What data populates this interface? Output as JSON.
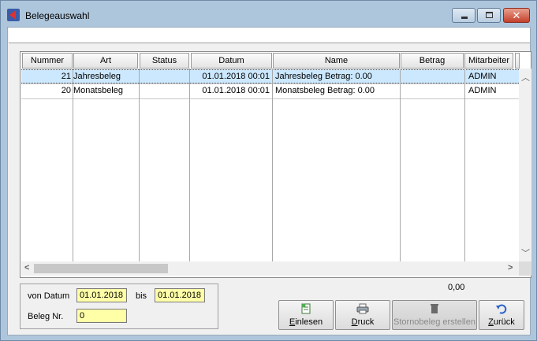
{
  "window": {
    "title": "Belegeauswahl",
    "controls": {
      "minimize": "–",
      "maximize": "□",
      "close": "✕"
    }
  },
  "table": {
    "headers": [
      "Nummer",
      "Art",
      "Status",
      "Datum",
      "Name",
      "Betrag",
      "Mitarbeiter"
    ],
    "rows": [
      {
        "nummer": "21",
        "art": "Jahresbeleg",
        "status": "",
        "datum": "01.01.2018  00:01",
        "name": "Jahresbeleg Betrag: 0.00",
        "betrag": "",
        "mitarbeiter": "ADMIN",
        "selected": true
      },
      {
        "nummer": "20",
        "art": "Monatsbeleg",
        "status": "",
        "datum": "01.01.2018  00:01",
        "name": "Monatsbeleg Betrag: 0.00",
        "betrag": "",
        "mitarbeiter": "ADMIN",
        "selected": false
      }
    ],
    "scroll": {
      "left": "<",
      "right": ">",
      "up": "︿",
      "down": "﹀"
    }
  },
  "filter": {
    "von_label": "von Datum",
    "von_value": "01.01.2018",
    "bis_label": "bis",
    "bis_value": "01.01.2018",
    "beleg_label": "Beleg Nr.",
    "beleg_value": "0"
  },
  "summary": {
    "total": "0,00"
  },
  "buttons": {
    "einlesen": {
      "hotkey": "E",
      "rest": "inlesen",
      "icon": "import-icon"
    },
    "druck": {
      "hotkey": "D",
      "rest": "ruck",
      "icon": "printer-icon"
    },
    "storno": {
      "label": "Stornobeleg erstellen",
      "icon": "trash-icon"
    },
    "zurueck": {
      "hotkey": "Z",
      "rest": "urück",
      "icon": "undo-icon"
    }
  },
  "colors": {
    "titlebar": "#aec6dc",
    "selection": "#cce8ff",
    "input_bg": "#ffffa8",
    "close_red": "#c4402b"
  }
}
